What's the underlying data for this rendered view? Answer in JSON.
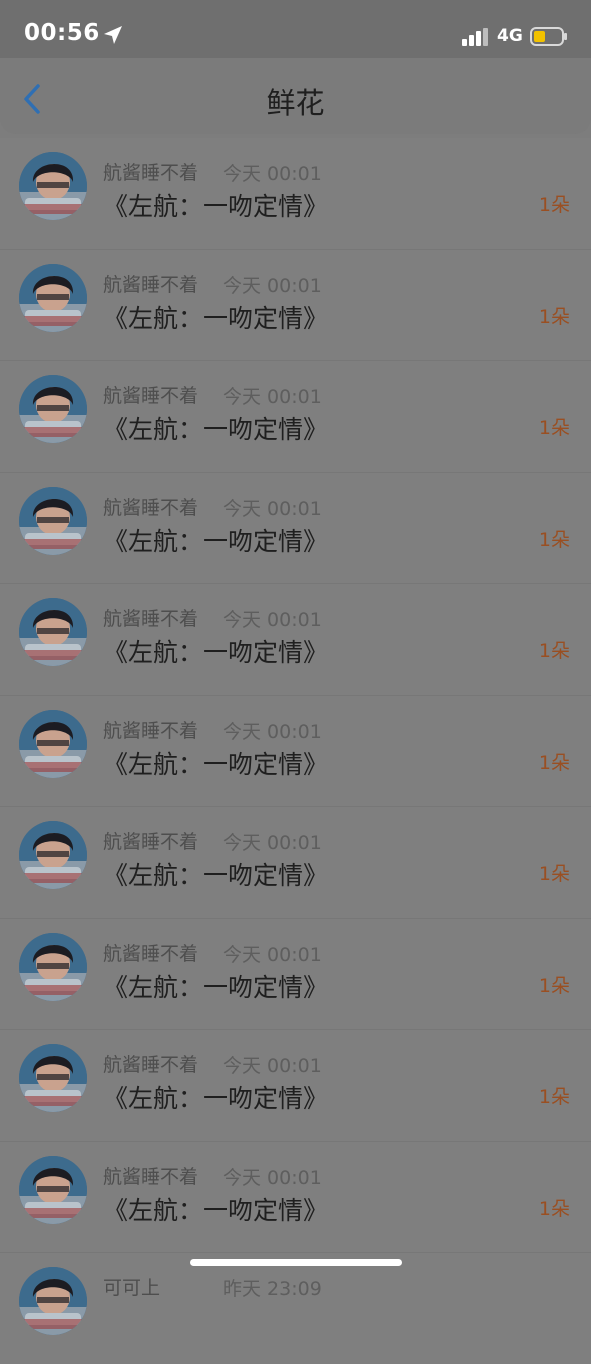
{
  "status_bar": {
    "time": "00:56",
    "network": "4G"
  },
  "nav": {
    "title": "鲜花"
  },
  "list": [
    {
      "user": "航酱睡不着",
      "time": "今天 00:01",
      "title": "《左航：一吻定情》",
      "count": "1朵"
    },
    {
      "user": "航酱睡不着",
      "time": "今天 00:01",
      "title": "《左航：一吻定情》",
      "count": "1朵"
    },
    {
      "user": "航酱睡不着",
      "time": "今天 00:01",
      "title": "《左航：一吻定情》",
      "count": "1朵"
    },
    {
      "user": "航酱睡不着",
      "time": "今天 00:01",
      "title": "《左航：一吻定情》",
      "count": "1朵"
    },
    {
      "user": "航酱睡不着",
      "time": "今天 00:01",
      "title": "《左航：一吻定情》",
      "count": "1朵"
    },
    {
      "user": "航酱睡不着",
      "time": "今天 00:01",
      "title": "《左航：一吻定情》",
      "count": "1朵"
    },
    {
      "user": "航酱睡不着",
      "time": "今天 00:01",
      "title": "《左航：一吻定情》",
      "count": "1朵"
    },
    {
      "user": "航酱睡不着",
      "time": "今天 00:01",
      "title": "《左航：一吻定情》",
      "count": "1朵"
    },
    {
      "user": "航酱睡不着",
      "time": "今天 00:01",
      "title": "《左航：一吻定情》",
      "count": "1朵"
    },
    {
      "user": "航酱睡不着",
      "time": "今天 00:01",
      "title": "《左航：一吻定情》",
      "count": "1朵"
    },
    {
      "user": "可可上",
      "time": "昨天 23:09",
      "title": "",
      "count": ""
    }
  ],
  "colors": {
    "overlay": "#7d7d7d",
    "count": "#9a4f22",
    "accent": "#2f6fb3"
  }
}
